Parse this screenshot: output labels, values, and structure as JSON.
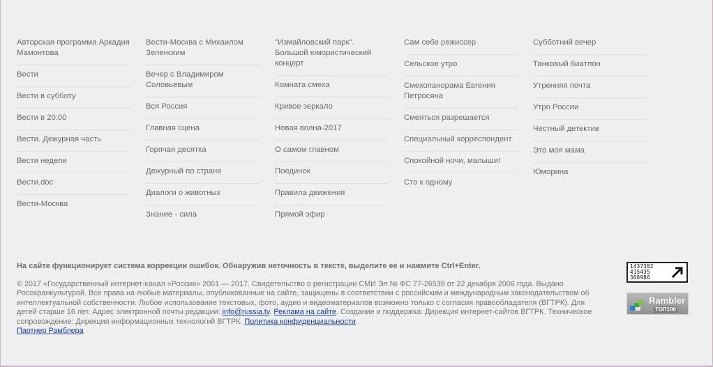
{
  "columns": [
    [
      "Авторская программа Аркадия Мамонтова",
      "Вести",
      "Вести в субботу",
      "Вести в 20:00",
      "Вести. Дежурная часть",
      "Вести недели",
      "Вести.doc",
      "Вести-Москва"
    ],
    [
      "Вести-Москва с Михаилом Зеленским",
      "Вечер с Владимиром Соловьевым",
      "Вся Россия",
      "Главная сцена",
      "Горячая десятка",
      "Дежурный по стране",
      "Диалоги о животных",
      "Знание - сила"
    ],
    [
      "\"Измайловский парк\". Большой юмористический концерт",
      "Комната смеха",
      "Кривое зеркало",
      "Новая волна-2017",
      "О самом главном",
      "Поединок",
      "Правила движения",
      "Прямой эфир"
    ],
    [
      "Сам себе режиссер",
      "Сельское утро",
      "Смехопанорама Евгения Петросяна",
      "Смеяться разрешается",
      "Специальный корреспондент",
      "Спокойной ночи, малыши!",
      "Сто к одному"
    ],
    [
      "Субботний вечер",
      "Танковый биатлон",
      "Утренняя почта",
      "Утро России",
      "Честный детектив",
      "Это моя мама",
      "Юморина"
    ]
  ],
  "footer": {
    "notice": "На сайте функционирует система коррекции ошибок. Обнаружив неточность в тексте, выделите ее и нажмите Ctrl+Enter.",
    "legal_main": "© 2017 «Государственный интернет-канал «Россия» 2001 — 2017. Свидетельство о регистрации СМИ Эл № ФС 77-26539 от 22 декабря 2006 года. Выдано Росохранкультурой. Все права на любые материалы, опубликованные на сайте, защищены в соответствии с российским и международным законодательством об интеллектуальной собственности. Любое использование текстовых, фото, аудио и видеоматериалов возможно только с согласия правообладателя (ВГТРК). Для детей старше 16 лет. Адрес электронной почты редакции: ",
    "email_link": "info@russia.tv",
    "sep1": ". ",
    "ads_link": "Реклама на сайте",
    "legal_tail": ". Создание и поддержка: Дирекция интернет-сайтов ВГТРК. Техническое сопровождение: Дирекция информационных технологий ВГТРК. ",
    "privacy_link": "Политика конфиденциальности",
    "end": ".",
    "partner_link": "Партнер Рамблера"
  },
  "counter": {
    "line1": "1437302",
    "line2": "415435",
    "line3": "308986"
  },
  "rambler": {
    "name": "Rambler",
    "top": "ТОП100"
  }
}
